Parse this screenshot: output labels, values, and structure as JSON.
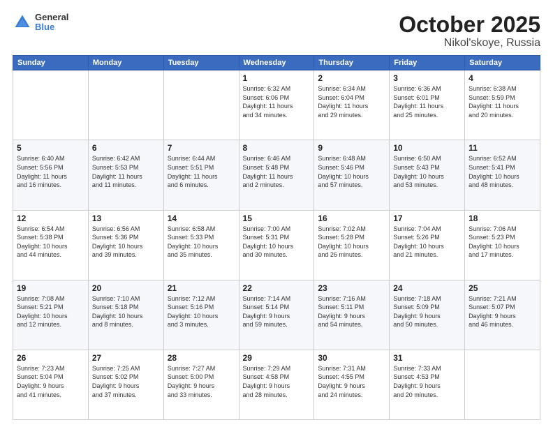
{
  "header": {
    "logo_line1": "General",
    "logo_line2": "Blue",
    "title": "October 2025",
    "subtitle": "Nikol'skoye, Russia"
  },
  "days_of_week": [
    "Sunday",
    "Monday",
    "Tuesday",
    "Wednesday",
    "Thursday",
    "Friday",
    "Saturday"
  ],
  "weeks": [
    [
      {
        "day": "",
        "info": ""
      },
      {
        "day": "",
        "info": ""
      },
      {
        "day": "",
        "info": ""
      },
      {
        "day": "1",
        "info": "Sunrise: 6:32 AM\nSunset: 6:06 PM\nDaylight: 11 hours\nand 34 minutes."
      },
      {
        "day": "2",
        "info": "Sunrise: 6:34 AM\nSunset: 6:04 PM\nDaylight: 11 hours\nand 29 minutes."
      },
      {
        "day": "3",
        "info": "Sunrise: 6:36 AM\nSunset: 6:01 PM\nDaylight: 11 hours\nand 25 minutes."
      },
      {
        "day": "4",
        "info": "Sunrise: 6:38 AM\nSunset: 5:59 PM\nDaylight: 11 hours\nand 20 minutes."
      }
    ],
    [
      {
        "day": "5",
        "info": "Sunrise: 6:40 AM\nSunset: 5:56 PM\nDaylight: 11 hours\nand 16 minutes."
      },
      {
        "day": "6",
        "info": "Sunrise: 6:42 AM\nSunset: 5:53 PM\nDaylight: 11 hours\nand 11 minutes."
      },
      {
        "day": "7",
        "info": "Sunrise: 6:44 AM\nSunset: 5:51 PM\nDaylight: 11 hours\nand 6 minutes."
      },
      {
        "day": "8",
        "info": "Sunrise: 6:46 AM\nSunset: 5:48 PM\nDaylight: 11 hours\nand 2 minutes."
      },
      {
        "day": "9",
        "info": "Sunrise: 6:48 AM\nSunset: 5:46 PM\nDaylight: 10 hours\nand 57 minutes."
      },
      {
        "day": "10",
        "info": "Sunrise: 6:50 AM\nSunset: 5:43 PM\nDaylight: 10 hours\nand 53 minutes."
      },
      {
        "day": "11",
        "info": "Sunrise: 6:52 AM\nSunset: 5:41 PM\nDaylight: 10 hours\nand 48 minutes."
      }
    ],
    [
      {
        "day": "12",
        "info": "Sunrise: 6:54 AM\nSunset: 5:38 PM\nDaylight: 10 hours\nand 44 minutes."
      },
      {
        "day": "13",
        "info": "Sunrise: 6:56 AM\nSunset: 5:36 PM\nDaylight: 10 hours\nand 39 minutes."
      },
      {
        "day": "14",
        "info": "Sunrise: 6:58 AM\nSunset: 5:33 PM\nDaylight: 10 hours\nand 35 minutes."
      },
      {
        "day": "15",
        "info": "Sunrise: 7:00 AM\nSunset: 5:31 PM\nDaylight: 10 hours\nand 30 minutes."
      },
      {
        "day": "16",
        "info": "Sunrise: 7:02 AM\nSunset: 5:28 PM\nDaylight: 10 hours\nand 26 minutes."
      },
      {
        "day": "17",
        "info": "Sunrise: 7:04 AM\nSunset: 5:26 PM\nDaylight: 10 hours\nand 21 minutes."
      },
      {
        "day": "18",
        "info": "Sunrise: 7:06 AM\nSunset: 5:23 PM\nDaylight: 10 hours\nand 17 minutes."
      }
    ],
    [
      {
        "day": "19",
        "info": "Sunrise: 7:08 AM\nSunset: 5:21 PM\nDaylight: 10 hours\nand 12 minutes."
      },
      {
        "day": "20",
        "info": "Sunrise: 7:10 AM\nSunset: 5:18 PM\nDaylight: 10 hours\nand 8 minutes."
      },
      {
        "day": "21",
        "info": "Sunrise: 7:12 AM\nSunset: 5:16 PM\nDaylight: 10 hours\nand 3 minutes."
      },
      {
        "day": "22",
        "info": "Sunrise: 7:14 AM\nSunset: 5:14 PM\nDaylight: 9 hours\nand 59 minutes."
      },
      {
        "day": "23",
        "info": "Sunrise: 7:16 AM\nSunset: 5:11 PM\nDaylight: 9 hours\nand 54 minutes."
      },
      {
        "day": "24",
        "info": "Sunrise: 7:18 AM\nSunset: 5:09 PM\nDaylight: 9 hours\nand 50 minutes."
      },
      {
        "day": "25",
        "info": "Sunrise: 7:21 AM\nSunset: 5:07 PM\nDaylight: 9 hours\nand 46 minutes."
      }
    ],
    [
      {
        "day": "26",
        "info": "Sunrise: 7:23 AM\nSunset: 5:04 PM\nDaylight: 9 hours\nand 41 minutes."
      },
      {
        "day": "27",
        "info": "Sunrise: 7:25 AM\nSunset: 5:02 PM\nDaylight: 9 hours\nand 37 minutes."
      },
      {
        "day": "28",
        "info": "Sunrise: 7:27 AM\nSunset: 5:00 PM\nDaylight: 9 hours\nand 33 minutes."
      },
      {
        "day": "29",
        "info": "Sunrise: 7:29 AM\nSunset: 4:58 PM\nDaylight: 9 hours\nand 28 minutes."
      },
      {
        "day": "30",
        "info": "Sunrise: 7:31 AM\nSunset: 4:55 PM\nDaylight: 9 hours\nand 24 minutes."
      },
      {
        "day": "31",
        "info": "Sunrise: 7:33 AM\nSunset: 4:53 PM\nDaylight: 9 hours\nand 20 minutes."
      },
      {
        "day": "",
        "info": ""
      }
    ]
  ]
}
